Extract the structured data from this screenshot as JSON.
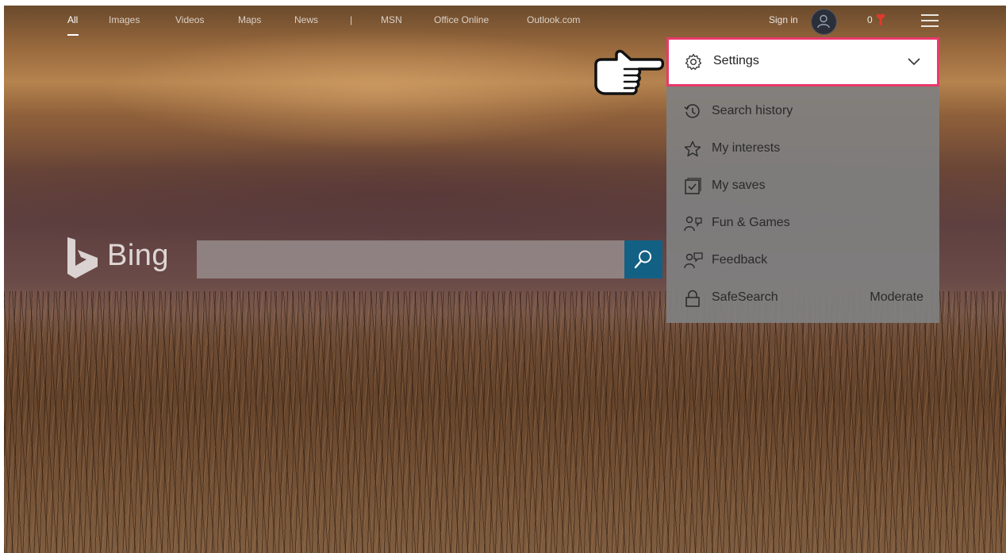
{
  "nav": {
    "items": [
      {
        "label": "All",
        "active": true
      },
      {
        "label": "Images"
      },
      {
        "label": "Videos"
      },
      {
        "label": "Maps"
      },
      {
        "label": "News"
      },
      {
        "label": "|"
      },
      {
        "label": "MSN"
      },
      {
        "label": "Office Online"
      },
      {
        "label": "Outlook.com"
      }
    ],
    "sign_in": "Sign in",
    "rewards_count": "0"
  },
  "logo": {
    "text": "Bing"
  },
  "search": {
    "value": "",
    "placeholder": ""
  },
  "menu": {
    "settings_label": "Settings",
    "items": [
      {
        "label": "Search history",
        "icon": "history-icon"
      },
      {
        "label": "My interests",
        "icon": "star-icon"
      },
      {
        "label": "My saves",
        "icon": "saves-icon"
      },
      {
        "label": "Fun & Games",
        "icon": "games-icon"
      },
      {
        "label": "Feedback",
        "icon": "feedback-icon"
      },
      {
        "label": "SafeSearch",
        "icon": "lock-icon",
        "value": "Moderate"
      }
    ]
  },
  "colors": {
    "highlight_border": "#e8396a",
    "search_button": "#136085",
    "rewards_accent": "#e1392b"
  }
}
